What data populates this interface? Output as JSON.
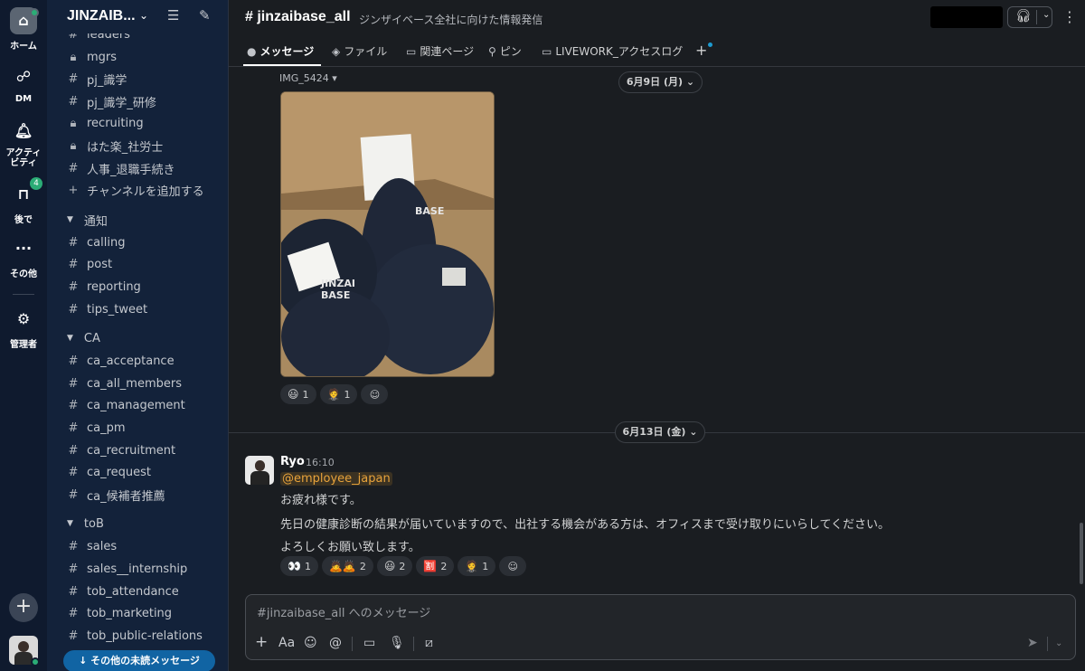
{
  "rail": {
    "home": "ホーム",
    "dm": "DM",
    "activity": "アクティ\nビティ",
    "later": "後で",
    "later_badge": "4",
    "more": "その他",
    "admin": "管理者"
  },
  "workspace": {
    "name": "JINZAIB...",
    "chevron": "⌄"
  },
  "sidebar": {
    "items_top": [
      {
        "kind": "hash",
        "label": "leaders"
      },
      {
        "kind": "lock",
        "label": "mgrs"
      },
      {
        "kind": "hash",
        "label": "pj_識学"
      },
      {
        "kind": "hash",
        "label": "pj_識学_研修"
      },
      {
        "kind": "lock",
        "label": "recruiting"
      },
      {
        "kind": "lock",
        "label": "はた楽_社労士"
      },
      {
        "kind": "hash",
        "label": "人事_退職手続き"
      },
      {
        "kind": "plus",
        "label": "チャンネルを追加する"
      }
    ],
    "sections": [
      {
        "title": "通知",
        "items": [
          "calling",
          "post",
          "reporting",
          "tips_tweet"
        ]
      },
      {
        "title": "CA",
        "items": [
          "ca_acceptance",
          "ca_all_members",
          "ca_management",
          "ca_pm",
          "ca_recruitment",
          "ca_request",
          "ca_候補者推薦"
        ]
      },
      {
        "title": "toB",
        "items": [
          "sales",
          "sales__internship",
          "tob_attendance",
          "tob_marketing",
          "tob_public-relations"
        ]
      }
    ],
    "unread_pill": "↓ その他の未読メッセージ"
  },
  "channel": {
    "name": "# jinzaibase_all",
    "description": "ジンザイベース全社に向けた情報発信"
  },
  "tabs": [
    {
      "label": "メッセージ",
      "icon": "●"
    },
    {
      "label": "ファイル",
      "icon": "◈"
    },
    {
      "label": "関連ページ",
      "icon": "▭"
    },
    {
      "label": "ピン",
      "icon": "⚲"
    },
    {
      "label": "LIVEWORK_アクセスログ",
      "icon": "▭"
    }
  ],
  "tab_add": "+",
  "file": {
    "name": "IMG_5424 ▾"
  },
  "date_dividers": [
    "6月9日 (月) ⌄",
    "6月13日 (金) ⌄"
  ],
  "photo_reactions": [
    {
      "emoji": "😃",
      "count": "1"
    },
    {
      "emoji": "🤵",
      "count": "1"
    }
  ],
  "message": {
    "author": "Ryo",
    "time": "16:10",
    "mention": "@employee_japan",
    "lines": [
      "お疲れ様です。",
      "先日の健康診断の結果が届いていますので、出社する機会がある方は、オフィスまで受け取りにいらしてください。",
      "よろしくお願い致します。"
    ],
    "reactions": [
      {
        "emoji": "👀",
        "count": "1"
      },
      {
        "emoji": "🙇🙇",
        "count": "2"
      },
      {
        "emoji": "😃",
        "count": "2"
      },
      {
        "emoji": "🈹",
        "count": "2"
      },
      {
        "emoji": "🤵",
        "count": "1"
      }
    ]
  },
  "composer": {
    "placeholder": "#jinzaibase_all へのメッセージ"
  },
  "colors": {
    "accent": "#1164a3",
    "online": "#2bac76",
    "mention": "#e8a33b",
    "sidebar_bg": "#13223a"
  }
}
